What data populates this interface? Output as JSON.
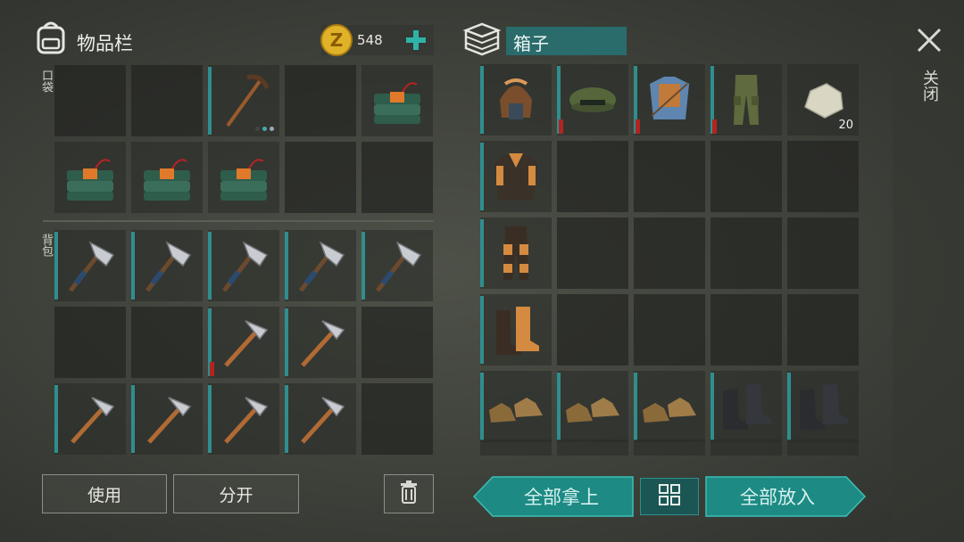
{
  "inventory": {
    "title": "物品栏",
    "coins": "548",
    "pocket_label": "口袋",
    "backpack_label": "背包",
    "pocket_slots": [
      {
        "item": "empty"
      },
      {
        "item": "empty"
      },
      {
        "item": "pickaxe"
      },
      {
        "item": "empty"
      },
      {
        "item": "c4-explosive"
      },
      {
        "item": "c4-explosive"
      },
      {
        "item": "c4-explosive"
      },
      {
        "item": "c4-explosive"
      },
      {
        "item": "empty"
      },
      {
        "item": "empty"
      }
    ],
    "backpack_slots": [
      {
        "item": "hatchet"
      },
      {
        "item": "hatchet"
      },
      {
        "item": "hatchet"
      },
      {
        "item": "hatchet"
      },
      {
        "item": "hatchet"
      },
      {
        "item": "empty"
      },
      {
        "item": "empty"
      },
      {
        "item": "pickaxe-stone"
      },
      {
        "item": "pickaxe-stone"
      },
      {
        "item": "empty"
      },
      {
        "item": "pickaxe-stone"
      },
      {
        "item": "pickaxe-stone"
      },
      {
        "item": "pickaxe-stone"
      },
      {
        "item": "pickaxe-stone"
      },
      {
        "item": "empty"
      }
    ]
  },
  "box": {
    "title": "箱子",
    "slots": [
      {
        "item": "aviator-hat"
      },
      {
        "item": "camo-cap"
      },
      {
        "item": "blue-vest-shirt"
      },
      {
        "item": "camo-pants"
      },
      {
        "item": "stone",
        "count": "20"
      },
      {
        "item": "leather-jacket"
      },
      {
        "item": "empty"
      },
      {
        "item": "empty"
      },
      {
        "item": "empty"
      },
      {
        "item": "empty"
      },
      {
        "item": "leather-pants"
      },
      {
        "item": "empty"
      },
      {
        "item": "empty"
      },
      {
        "item": "empty"
      },
      {
        "item": "empty"
      },
      {
        "item": "leather-boots"
      },
      {
        "item": "empty"
      },
      {
        "item": "empty"
      },
      {
        "item": "empty"
      },
      {
        "item": "empty"
      },
      {
        "item": "brown-shoes"
      },
      {
        "item": "brown-shoes"
      },
      {
        "item": "brown-shoes"
      },
      {
        "item": "black-boots"
      },
      {
        "item": "black-boots"
      }
    ]
  },
  "buttons": {
    "use": "使用",
    "split": "分开",
    "take_all": "全部拿上",
    "put_all": "全部放入",
    "close": "关闭"
  },
  "icons": {
    "backpack": "backpack-icon",
    "coin": "coin-icon",
    "add": "plus-icon",
    "box": "box-icon",
    "trash": "trash-icon",
    "sort": "grid-sort-icon",
    "close": "close-icon"
  },
  "colors": {
    "accent": "#2f8e8e",
    "teal_button": "#1f8c86",
    "durability_low": "#b3241f"
  }
}
